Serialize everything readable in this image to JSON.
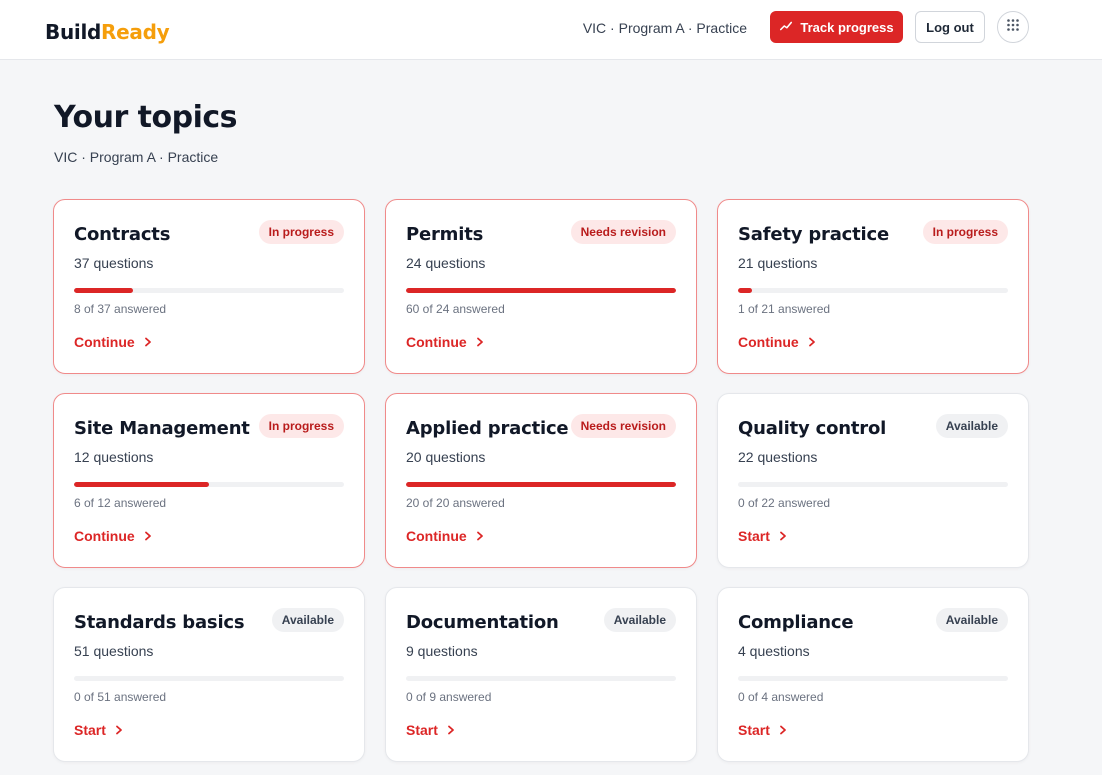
{
  "header": {
    "logo_part1": "Build",
    "logo_part2": "Ready",
    "context": "VIC · Program A · Practice",
    "track_label": "Track progress",
    "logout_label": "Log out"
  },
  "page": {
    "title": "Your topics",
    "subtitle": "VIC · Program A · Practice"
  },
  "colors": {
    "accent": "#dc2626",
    "brand_secondary": "#f59e0b"
  },
  "topics": [
    {
      "title": "Contracts",
      "questions": "37 questions",
      "badge": "In progress",
      "status": "inprogress",
      "answered": "8 of 37 answered",
      "progress": 0.22,
      "action": "Continue"
    },
    {
      "title": "Permits",
      "questions": "24 questions",
      "badge": "Needs revision",
      "status": "revision",
      "answered": "60 of 24 answered",
      "progress": 1.0,
      "action": "Continue"
    },
    {
      "title": "Safety practice",
      "questions": "21 questions",
      "badge": "In progress",
      "status": "inprogress",
      "answered": "1 of 21 answered",
      "progress": 0.05,
      "action": "Continue"
    },
    {
      "title": "Site Management",
      "questions": "12 questions",
      "badge": "In progress",
      "status": "inprogress",
      "answered": "6 of 12 answered",
      "progress": 0.5,
      "action": "Continue"
    },
    {
      "title": "Applied practice",
      "questions": "20 questions",
      "badge": "Needs revision",
      "status": "revision",
      "answered": "20 of 20 answered",
      "progress": 1.0,
      "action": "Continue"
    },
    {
      "title": "Quality control",
      "questions": "22 questions",
      "badge": "Available",
      "status": "available",
      "answered": "0 of 22 answered",
      "progress": 0,
      "action": "Start"
    },
    {
      "title": "Standards basics",
      "questions": "51 questions",
      "badge": "Available",
      "status": "available",
      "answered": "0 of 51 answered",
      "progress": 0,
      "action": "Start"
    },
    {
      "title": "Documentation",
      "questions": "9 questions",
      "badge": "Available",
      "status": "available",
      "answered": "0 of 9 answered",
      "progress": 0,
      "action": "Start"
    },
    {
      "title": "Compliance",
      "questions": "4 questions",
      "badge": "Available",
      "status": "available",
      "answered": "0 of 4 answered",
      "progress": 0,
      "action": "Start"
    }
  ]
}
